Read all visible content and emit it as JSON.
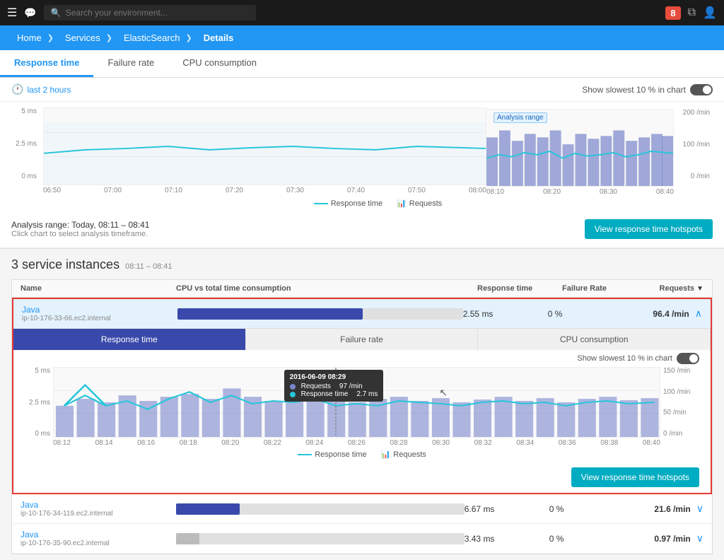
{
  "topNav": {
    "searchPlaceholder": "Search your environment...",
    "badge": "8"
  },
  "breadcrumb": {
    "items": [
      "Home",
      "Services",
      "ElasticSearch",
      "Details"
    ]
  },
  "topTabs": [
    {
      "label": "Response time",
      "active": true
    },
    {
      "label": "Failure rate",
      "active": false
    },
    {
      "label": "CPU consumption",
      "active": false
    }
  ],
  "timeRange": {
    "label": "last 2 hours",
    "showSlowest": "Show slowest 10 % in chart"
  },
  "chart": {
    "yAxisLeft": [
      "5 ms",
      "2.5 ms",
      "0 ms"
    ],
    "yAxisRight": [
      "200 /min",
      "100 /min",
      "0 /min"
    ],
    "xAxisLabels": [
      "06:50",
      "07:00",
      "07:10",
      "07:20",
      "07:30",
      "07:40",
      "07:50",
      "08:00"
    ],
    "analysisRangeLabel": "Analysis range",
    "legend": {
      "responseLine": "Response time",
      "requestsBars": "Requests"
    }
  },
  "analysisRange": {
    "title": "Analysis range: Today, 08:11 – 08:41",
    "subtitle": "Click chart to select analysis timeframe.",
    "btnLabel": "View response time hotspots"
  },
  "instances": {
    "title": "3 service instances",
    "timeRange": "08:11 – 08:41",
    "tableHeaders": {
      "name": "Name",
      "cpu": "CPU vs total time consumption",
      "response": "Response time",
      "failure": "Failure Rate",
      "requests": "Requests"
    },
    "rows": [
      {
        "name": "Java",
        "ip": "ip-10-176-33-66.ec2.internal",
        "cpuPercent": 65,
        "response": "2.55 ms",
        "failure": "0 %",
        "requests": "96.4 /min",
        "highlighted": true,
        "expanded": true
      },
      {
        "name": "Java",
        "ip": "ip-10-176-34-119.ec2.internal",
        "cpuPercent": 22,
        "response": "6.67 ms",
        "failure": "0 %",
        "requests": "21.6 /min",
        "highlighted": false,
        "expanded": false
      },
      {
        "name": "Java",
        "ip": "ip-10-176-35-90.ec2.internal",
        "cpuPercent": 8,
        "response": "3.43 ms",
        "failure": "0 %",
        "requests": "0.97 /min",
        "highlighted": false,
        "expanded": false
      }
    ]
  },
  "expandedChart": {
    "subTabs": [
      "Response time",
      "Failure rate",
      "CPU consumption"
    ],
    "activeTab": 0,
    "showSlowest": "Show slowest 10 % in chart",
    "yAxisLeft": [
      "5 ms",
      "2.5 ms",
      "0 ms"
    ],
    "yAxisRight": [
      "150 /min",
      "100 /min",
      "50 /min",
      "0 /min"
    ],
    "xAxisLabels": [
      "08:12",
      "08:14",
      "08:16",
      "08:18",
      "08:20",
      "08:22",
      "08:24",
      "08:26",
      "08:28",
      "08:30",
      "08:32",
      "08:34",
      "08:36",
      "08:38",
      "08:40"
    ],
    "tooltip": {
      "date": "2016-06-09 08:29",
      "requests": "97 /min",
      "responseTime": "2.7 ms"
    },
    "legend": {
      "responseLine": "Response time",
      "requestsBars": "Requests"
    },
    "btnLabel": "View response time hotspots"
  }
}
